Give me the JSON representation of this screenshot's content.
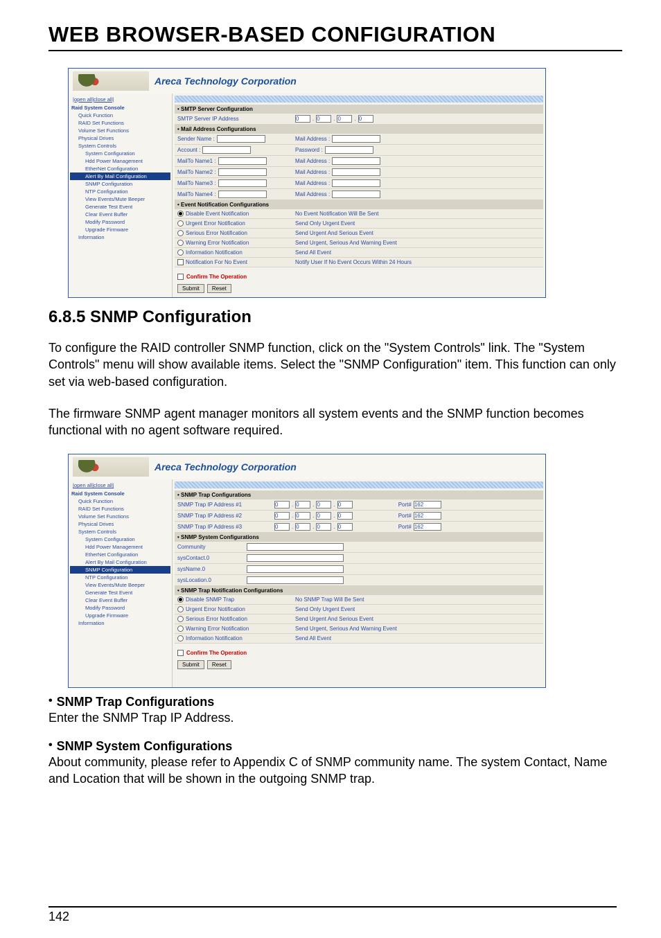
{
  "main_title": "WEB BROWSER-BASED CONFIGURATION",
  "section_title": "6.8.5 SNMP Configuration",
  "para1": "To configure the RAID controller SNMP function, click on the \"System Controls\" link. The \"System Controls\" menu will show available items. Select the \"SNMP Configuration\" item. This function can only set via web-based configuration.",
  "para2": "The firmware SNMP agent manager monitors all system events and the SNMP function becomes functional with no agent software required.",
  "bullet1_head": "SNMP Trap Configurations",
  "bullet1_body": "Enter the SNMP Trap IP Address.",
  "bullet2_head": "SNMP System Configurations",
  "bullet2_body": "About community, please refer to Appendix C of SNMP community name. The system Contact, Name and Location that will be shown in the outgoing SNMP trap.",
  "page_number": "142",
  "brand": "Areca Technology Corporation",
  "openclose": "|open all|close all|",
  "tree1": [
    "Raid System Console",
    "Quick Function",
    "RAID Set Functions",
    "Volume Set Functions",
    "Physical Drives",
    "System Controls",
    "System Configuration",
    "Hdd Power Management",
    "EtherNet Configuration",
    "Alert By Mail Configuration",
    "SNMP Configuration",
    "NTP Configuration",
    "View Events/Mute Beeper",
    "Generate Test Event",
    "Clear Event Buffer",
    "Modify Password",
    "Upgrade Firmware",
    "Information"
  ],
  "shot1": {
    "s1": "• SMTP Server Configuration",
    "r1": "SMTP Server IP Address",
    "s2": "• Mail Address Configurations",
    "sender": "Sender Name :",
    "mail": "Mail Address :",
    "acct": "Account :",
    "pass": "Password :",
    "mt1": "MailTo Name1 :",
    "mt2": "MailTo Name2 :",
    "mt3": "MailTo Name3 :",
    "mt4": "MailTo Name4 :",
    "s3": "• Event Notification Configurations",
    "o1l": "Disable Event Notification",
    "o1r": "No Event Notification Will Be Sent",
    "o2l": "Urgent Error Notification",
    "o2r": "Send Only Urgent Event",
    "o3l": "Serious Error Notification",
    "o3r": "Send Urgent And Serious Event",
    "o4l": "Warning Error Notification",
    "o4r": "Send Urgent, Serious And Warning Event",
    "o5l": "Information Notification",
    "o5r": "Send All Event",
    "o6l": "Notification For No Event",
    "o6r": "Notify User If No Event Occurs Within 24 Hours",
    "confirm": "Confirm The Operation",
    "btn_submit": "Submit",
    "btn_reset": "Reset",
    "ip0": "0"
  },
  "tree2": [
    "Raid System Console",
    "Quick Function",
    "RAID Set Functions",
    "Volume Set Functions",
    "Physical Drives",
    "System Controls",
    "System Configuration",
    "Hdd Power Management",
    "EtherNet Configuration",
    "Alert By Mail Configuration",
    "SNMP Configuration",
    "NTP Configuration",
    "View Events/Mute Beeper",
    "Generate Test Event",
    "Clear Event Buffer",
    "Modify Password",
    "Upgrade Firmware",
    "Information"
  ],
  "shot2": {
    "s1": "• SNMP Trap Configurations",
    "r1": "SNMP Trap IP Address #1",
    "r2": "SNMP Trap IP Address #2",
    "r3": "SNMP Trap IP Address #3",
    "port": "Port#",
    "portv": "162",
    "s2": "• SNMP System Configurations",
    "comm": "Community",
    "syscontact": "sysContact.0",
    "sysname": "sysName.0",
    "sysloc": "sysLocation.0",
    "s3": "• SNMP Trap Notification Configurations",
    "o1l": "Disable SNMP Trap",
    "o1r": "No SNMP Trap Will Be Sent",
    "o2l": "Urgent Error Notification",
    "o2r": "Send Only Urgent Event",
    "o3l": "Serious Error Notification",
    "o3r": "Send Urgent And Serious Event",
    "o4l": "Warning Error Notification",
    "o4r": "Send Urgent, Serious And Warning Event",
    "o5l": "Information Notification",
    "o5r": "Send All Event",
    "confirm": "Confirm The Operation",
    "btn_submit": "Submit",
    "btn_reset": "Reset",
    "ip0": "0"
  }
}
